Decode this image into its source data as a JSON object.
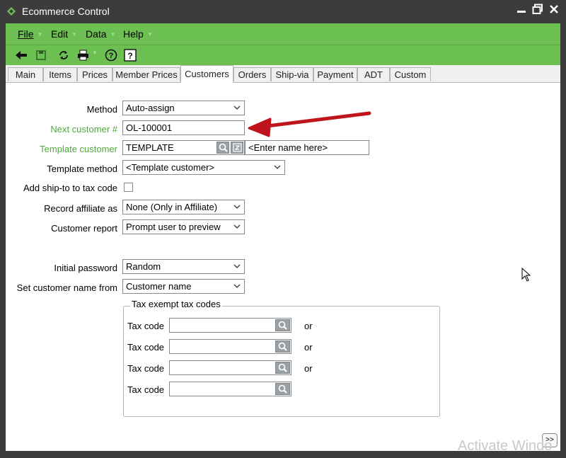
{
  "window": {
    "title": "Ecommerce Control",
    "app_icon": "sage-leaf-icon"
  },
  "menu": [
    {
      "label": "File"
    },
    {
      "label": "Edit"
    },
    {
      "label": "Data"
    },
    {
      "label": "Help"
    }
  ],
  "toolbar": {
    "icons": [
      "back-arrow-icon",
      "save-icon",
      "refresh-icon",
      "print-icon",
      "help-icon",
      "question-icon"
    ]
  },
  "tabs": [
    {
      "label": "Main"
    },
    {
      "label": "Items"
    },
    {
      "label": "Prices"
    },
    {
      "label": "Member Prices"
    },
    {
      "label": "Customers",
      "active": true
    },
    {
      "label": "Orders"
    },
    {
      "label": "Ship-via"
    },
    {
      "label": "Payment"
    },
    {
      "label": "ADT"
    },
    {
      "label": "Custom"
    }
  ],
  "form": {
    "method": {
      "label": "Method",
      "value": "Auto-assign"
    },
    "next_customer": {
      "label": "Next customer #",
      "value": "OL-100001"
    },
    "template_customer": {
      "label": "Template customer",
      "value": "TEMPLATE",
      "name_placeholder": "<Enter name here>"
    },
    "template_method": {
      "label": "Template method",
      "value": "<Template customer>"
    },
    "ship_to_tax": {
      "label": "Add ship-to to tax code",
      "checked": false
    },
    "record_affiliate": {
      "label": "Record affiliate as",
      "value": "None (Only in Affiliate)"
    },
    "customer_report": {
      "label": "Customer report",
      "value": "Prompt user to preview"
    },
    "initial_password": {
      "label": "Initial password",
      "value": "Random"
    },
    "customer_name_from": {
      "label": "Set customer name from",
      "value": "Customer name"
    },
    "tax_exempt": {
      "title": "Tax exempt tax codes",
      "rows": [
        {
          "label": "Tax code",
          "value": "",
          "suffix": "or"
        },
        {
          "label": "Tax code",
          "value": "",
          "suffix": "or"
        },
        {
          "label": "Tax code",
          "value": "",
          "suffix": "or"
        },
        {
          "label": "Tax code",
          "value": "",
          "suffix": ""
        }
      ]
    }
  },
  "expander_label": ">>",
  "watermark": "Activate Windo",
  "colors": {
    "accent_green": "#6cbf51",
    "label_green": "#4ea83a",
    "annotation_red": "#c0141c",
    "titlebar": "#3c3c3c"
  }
}
